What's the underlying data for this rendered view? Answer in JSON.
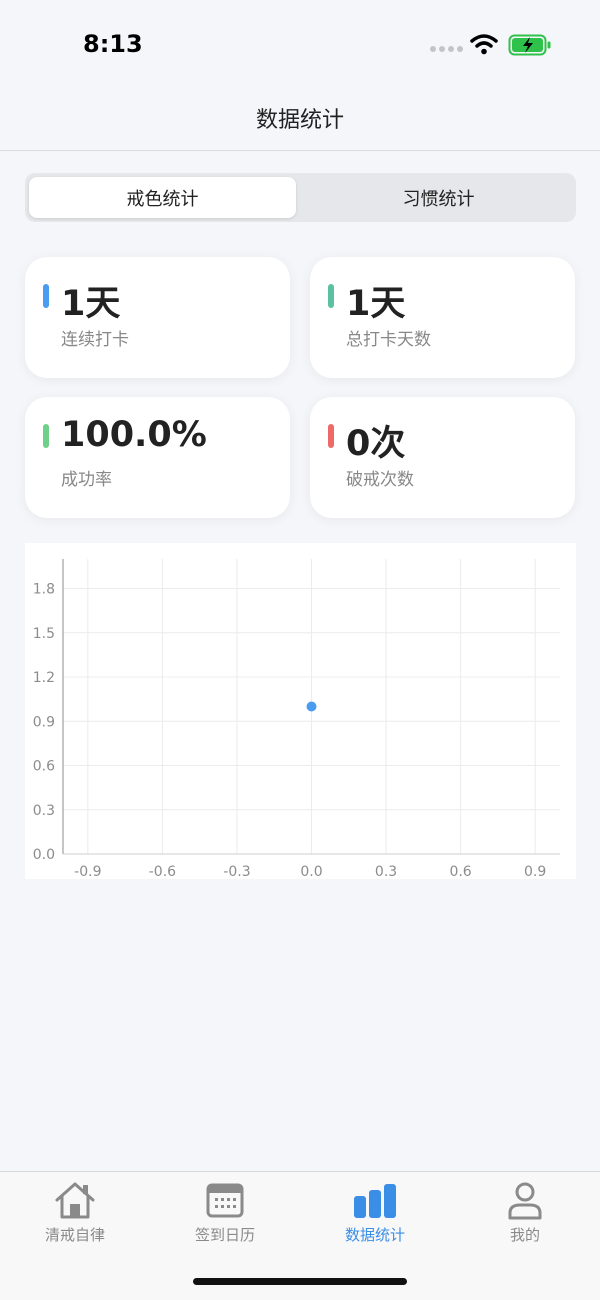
{
  "status_bar": {
    "time": "8:13"
  },
  "header": {
    "title": "数据统计"
  },
  "segment": {
    "tabs": [
      {
        "label": "戒色统计",
        "active": true
      },
      {
        "label": "习惯统计",
        "active": false
      }
    ]
  },
  "stats": [
    {
      "value": "1天",
      "label": "连续打卡",
      "color": "#4a9cf0"
    },
    {
      "value": "1天",
      "label": "总打卡天数",
      "color": "#5cc1a0"
    },
    {
      "value": "100.0%",
      "label": "成功率",
      "color": "#6fd08a"
    },
    {
      "value": "0次",
      "label": "破戒次数",
      "color": "#ee6a66"
    }
  ],
  "chart_data": {
    "type": "scatter",
    "title": "",
    "xlabel": "",
    "ylabel": "",
    "xlim": [
      -1.0,
      1.0
    ],
    "ylim": [
      0,
      2.0
    ],
    "x_ticks": [
      "-0.9",
      "-0.6",
      "-0.3",
      "0.0",
      "0.3",
      "0.6",
      "0.9"
    ],
    "y_ticks": [
      "0.0",
      "0.3",
      "0.6",
      "0.9",
      "1.2",
      "1.5",
      "1.8"
    ],
    "grid": true,
    "point_color": "#4a9cf0",
    "series": [
      {
        "points": [
          {
            "x": 0.0,
            "y": 1.0
          }
        ]
      }
    ]
  },
  "tab_bar": {
    "items": [
      {
        "label": "清戒自律",
        "icon": "home-icon",
        "active": false
      },
      {
        "label": "签到日历",
        "icon": "calendar-icon",
        "active": false
      },
      {
        "label": "数据统计",
        "icon": "bar-chart-icon",
        "active": true
      },
      {
        "label": "我的",
        "icon": "user-icon",
        "active": false
      }
    ]
  }
}
